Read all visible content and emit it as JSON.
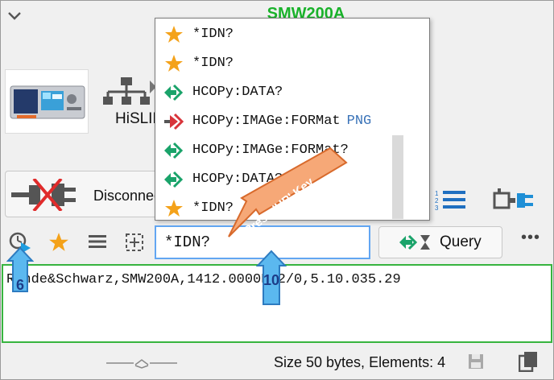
{
  "window": {
    "title": "SMW200A"
  },
  "instrument": {
    "protocol_label": "HiSLIP"
  },
  "connection": {
    "disconnect_label": "Disconnect"
  },
  "command": {
    "input_value": "*IDN?",
    "query_label": "Query",
    "more_label": "•••"
  },
  "history": {
    "items": [
      {
        "icon": "star-icon",
        "text": "*IDN?",
        "suffix": ""
      },
      {
        "icon": "star-icon",
        "text": "*IDN?",
        "suffix": ""
      },
      {
        "icon": "query-arrow-icon",
        "text": "HCOPy:DATA?",
        "suffix": ""
      },
      {
        "icon": "write-arrow-icon",
        "text": "HCOPy:IMAGe:FORMat",
        "suffix": "PNG"
      },
      {
        "icon": "query-arrow-icon",
        "text": "HCOPy:IMAGe:FORMat?",
        "suffix": ""
      },
      {
        "icon": "query-arrow-icon",
        "text": "HCOPy:DATA?",
        "suffix": ""
      },
      {
        "icon": "star-icon",
        "text": "*IDN?",
        "suffix": ""
      }
    ]
  },
  "response": {
    "text": "Rohde&Schwarz,SMW200A,1412.0000K02/0,5.10.035.29"
  },
  "status": {
    "text": "Size 50 bytes, Elements: 4"
  },
  "annotations": {
    "callout_history": "6",
    "callout_input": "10",
    "arrow_text": "Press 'UP' Key"
  },
  "colors": {
    "accent_green": "#19b22a",
    "input_border": "#62a6f2",
    "star": "#f4a21a",
    "callout_fill": "#5bb8ef",
    "arrow_fill": "#f6a877"
  }
}
